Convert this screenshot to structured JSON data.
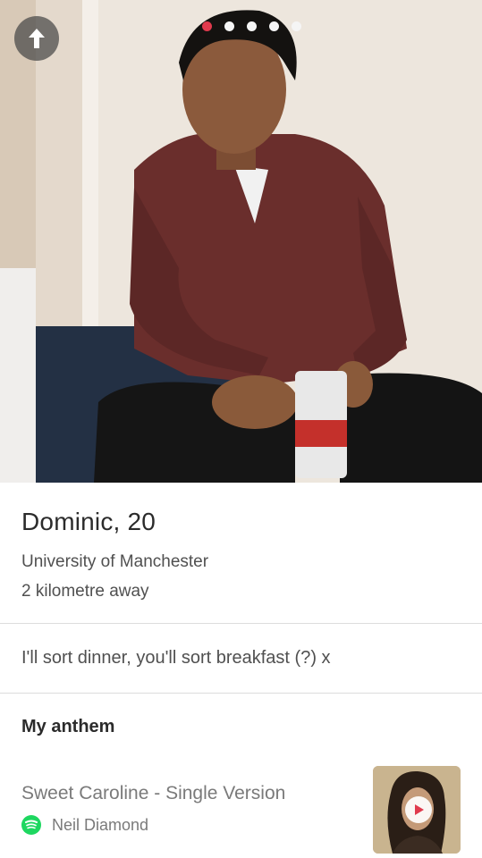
{
  "profile": {
    "name_age": "Dominic, 20",
    "school": "University of Manchester",
    "distance": "2 kilometre away",
    "bio": "I'll sort dinner, you'll sort breakfast (?) x"
  },
  "photo_nav": {
    "photo_count": 5,
    "active_index": 0,
    "up_icon": "arrow-up-icon"
  },
  "anthem": {
    "section_title": "My anthem",
    "song": "Sweet Caroline - Single Version",
    "artist": "Neil Diamond",
    "service_icon": "spotify-icon",
    "play_icon": "play-icon"
  },
  "colors": {
    "accent": "#e03a4d",
    "spotify": "#1ed760"
  }
}
